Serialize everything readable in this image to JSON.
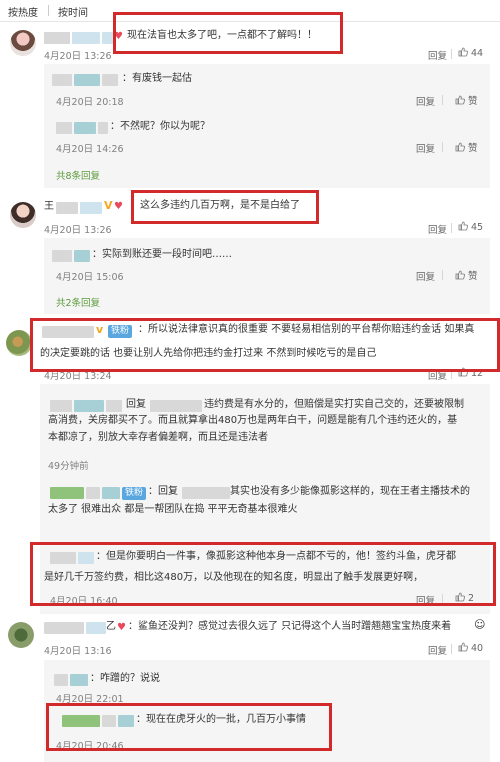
{
  "sort": {
    "by_hot": "按热度",
    "by_time": "按时间"
  },
  "action_reply": "回复",
  "comments": [
    {
      "text": "现在法盲也太多了吧，一点都不了解吗！！",
      "time": "4月20日 13:26",
      "likes": "44",
      "replies": [
        {
          "text": "有废钱一起估",
          "time": "4月20日 20:18",
          "likes": "赞"
        },
        {
          "text": "不然呢？你以为呢？",
          "time": "4月20日 14:26",
          "likes": "赞"
        }
      ],
      "more": "共8条回复"
    },
    {
      "name_visible": "王",
      "badge": "V",
      "text": "这么多违约几百万啊，是不是白给了",
      "time": "4月20日 13:26",
      "likes": "45",
      "replies": [
        {
          "text": "实际到账还要一段时间吧……",
          "time": "4月20日 15:06",
          "likes": "赞"
        }
      ],
      "more": "共2条回复"
    },
    {
      "badge": "v",
      "tag": "铁粉",
      "text_line1": "所以说法律意识真的很重要 不要轻易相信别的平台帮你赔违约金话 如果真",
      "text_line2": "的决定要跳的话 也要让别人先给你把违约金打过来 不然到时候吃亏的是自己",
      "time": "4月20日 13:24",
      "likes": "12",
      "replies": [
        {
          "label": "回复",
          "text_line1": "违约费是有水分的，但赔偿是实打实自己交的，还要被限制",
          "text_line2": "高消费，关房都买不了。而且就算拿出480万也是两年白干，问题是能有几个违约还火的，基",
          "text_line3": "本都凉了，别放大幸存者偏差啊，而且还是违法者",
          "time": "49分钟前"
        },
        {
          "tag": "铁粉",
          "label": "回复",
          "text_line1": "其实也没有多少能像孤影这样的，现在王者主播技术的",
          "text_line2": "太多了 很难出众 都是一帮团队在捣 平平无奇基本很难火"
        },
        {
          "text_line1": "但是你要明白一件事，像孤影这种他本身一点都不亏的，他！签约斗鱼，虎牙都",
          "text_line2": "是好几千万签约费，相比这480万，以及他现在的知名度，明显出了触手发展更好啊，",
          "time": "4月20日 16:40",
          "likes": "2"
        }
      ]
    },
    {
      "name_suffix": "乙",
      "text": "鲨鱼还没判？感觉过去很久远了 只记得这个人当时蹭翘翘宝宝热度来着",
      "time": "4月20日 13:16",
      "likes": "40",
      "replies": [
        {
          "text": "咋蹭的？说说",
          "time": "4月20日 22:01"
        },
        {
          "text": "现在在虎牙火的一批，几百万小事情",
          "time": "4月20日 20:46"
        }
      ]
    }
  ]
}
